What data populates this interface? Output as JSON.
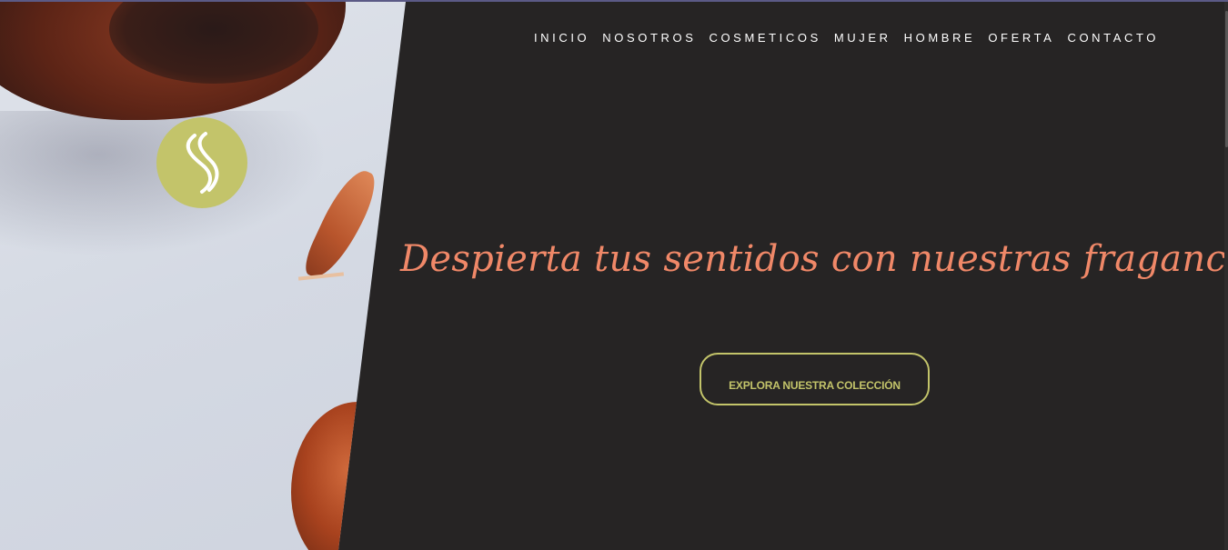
{
  "nav": {
    "items": [
      "INICIO",
      "NOSOTROS",
      "COSMETICOS",
      "MUJER",
      "HOMBRE",
      "OFERTA",
      "CONTACTO"
    ]
  },
  "hero": {
    "headline": "Despierta tus sentidos con nuestras fragancias",
    "cta_label": "EXPLORA NUESTRA COLECCIÓN"
  },
  "logo": {
    "icon": "swirl-s-logo-icon"
  },
  "colors": {
    "background": "#262424",
    "accent_green": "#c3c46a",
    "headline_coral": "#f08868",
    "nav_text": "#ffffff"
  }
}
